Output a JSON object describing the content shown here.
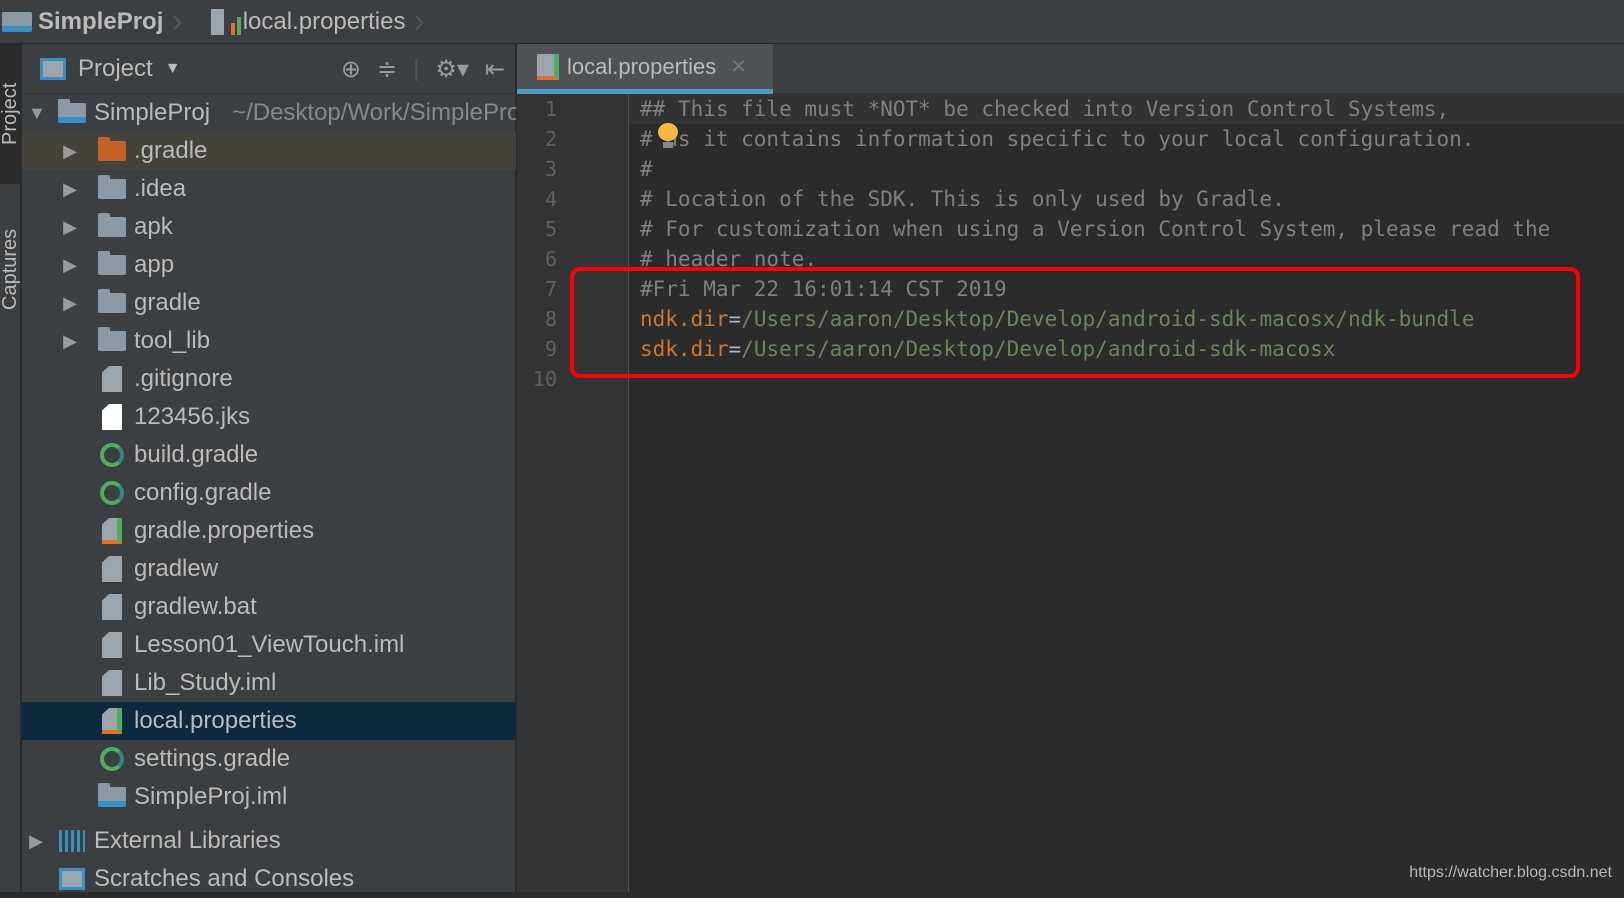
{
  "breadcrumb": {
    "project": "SimpleProj",
    "file": "local.properties"
  },
  "side_strip": {
    "tabs": [
      "Project",
      "Captures"
    ]
  },
  "project_panel": {
    "view_selector": "Project",
    "root": {
      "name": "SimpleProj",
      "path": "~/Desktop/Work/SimpleProj"
    },
    "items": [
      {
        "name": ".gradle",
        "type": "folder-excluded",
        "expandable": true
      },
      {
        "name": ".idea",
        "type": "folder",
        "expandable": true
      },
      {
        "name": "apk",
        "type": "folder",
        "expandable": true
      },
      {
        "name": "app",
        "type": "module-folder",
        "expandable": true
      },
      {
        "name": "gradle",
        "type": "folder",
        "expandable": true
      },
      {
        "name": "tool_lib",
        "type": "library-folder",
        "expandable": true
      },
      {
        "name": ".gitignore",
        "type": "text-file"
      },
      {
        "name": "123456.jks",
        "type": "file"
      },
      {
        "name": "build.gradle",
        "type": "gradle-file"
      },
      {
        "name": "config.gradle",
        "type": "gradle-file"
      },
      {
        "name": "gradle.properties",
        "type": "properties-file"
      },
      {
        "name": "gradlew",
        "type": "text-file"
      },
      {
        "name": "gradlew.bat",
        "type": "text-file"
      },
      {
        "name": "Lesson01_ViewTouch.iml",
        "type": "iml-file"
      },
      {
        "name": "Lib_Study.iml",
        "type": "iml-file"
      },
      {
        "name": "local.properties",
        "type": "properties-file",
        "selected": true
      },
      {
        "name": "settings.gradle",
        "type": "gradle-file"
      },
      {
        "name": "SimpleProj.iml",
        "type": "module-iml"
      }
    ],
    "bottom": [
      {
        "name": "External Libraries"
      },
      {
        "name": "Scratches and Consoles"
      }
    ]
  },
  "editor": {
    "tab": "local.properties",
    "lines": [
      {
        "n": "1",
        "text": "## This file must *NOT* be checked into Version Control Systems,"
      },
      {
        "n": "2",
        "text": "# as it contains information specific to your local configuration."
      },
      {
        "n": "3",
        "text": "#"
      },
      {
        "n": "4",
        "text": "# Location of the SDK. This is only used by Gradle."
      },
      {
        "n": "5",
        "text": "# For customization when using a Version Control System, please read the"
      },
      {
        "n": "6",
        "text": "# header note."
      },
      {
        "n": "7",
        "text": "#Fri Mar 22 16:01:14 CST 2019"
      },
      {
        "n": "8",
        "key": "ndk.dir",
        "eq": "=",
        "val": "/Users/aaron/Desktop/Develop/android-sdk-macosx/ndk-bundle"
      },
      {
        "n": "9",
        "key": "sdk.dir",
        "eq": "=",
        "val": "/Users/aaron/Desktop/Develop/android-sdk-macosx"
      },
      {
        "n": "10",
        "text": ""
      }
    ]
  },
  "colors": {
    "highlight_box": "#ff0000",
    "key": "#cc7832",
    "value": "#6a8759",
    "comment": "#808080",
    "selection": "#0d293e"
  },
  "watermark": "https://watcher.blog.csdn.net"
}
